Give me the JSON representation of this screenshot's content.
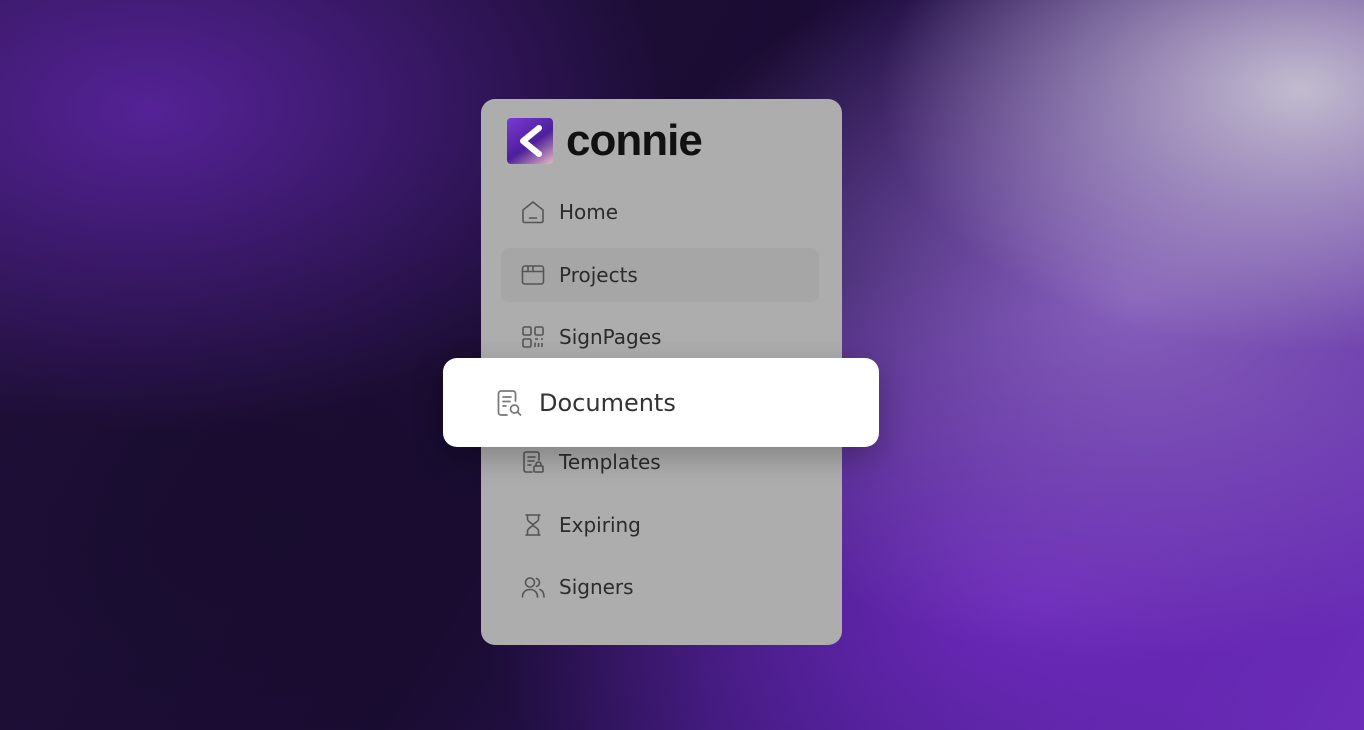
{
  "brand": {
    "name": "connie",
    "logo_icon": "chevron-left-logo-icon",
    "logo_colors": [
      "#7a3ad6",
      "#4d1f9a",
      "#e7b9c1"
    ]
  },
  "sidebar": {
    "items": [
      {
        "label": "Home",
        "icon": "home-icon"
      },
      {
        "label": "Projects",
        "icon": "browser-window-icon",
        "state": "hover"
      },
      {
        "label": "SignPages",
        "icon": "qr-code-icon"
      },
      {
        "label": "Documents",
        "icon": "document-search-icon",
        "state": "highlighted"
      },
      {
        "label": "Templates",
        "icon": "document-lock-icon"
      },
      {
        "label": "Expiring",
        "icon": "hourglass-icon"
      },
      {
        "label": "Signers",
        "icon": "users-icon"
      }
    ]
  },
  "colors": {
    "sidebar_bg": "#adadad",
    "hover_bg": "#a6a6a6",
    "highlight_card_bg": "#ffffff",
    "text": "#2b2b2b"
  }
}
